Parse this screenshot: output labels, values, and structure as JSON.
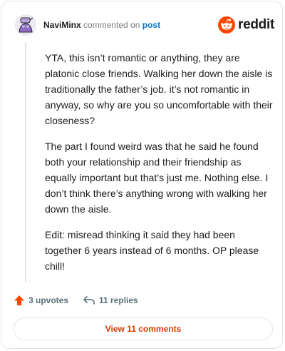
{
  "header": {
    "username": "NaviMinx",
    "action_text": "commented on",
    "post_link_label": "post",
    "brand_wordmark": "reddit"
  },
  "comment": {
    "paragraphs": [
      "YTA, this isn’t romantic or anything, they are platonic close friends. Walking her down the aisle is traditionally the father’s job. it’s not romantic in anyway, so why are you so uncomfortable with their closeness?",
      "The part I found weird was that he said he found both your relationship and their friendship as equally important but that’s just me. Nothing else. I don’t think there’s anything wrong with walking her down the aisle.",
      "Edit: misread thinking it said they had been together 6 years instead of 6 months. OP please chill!"
    ]
  },
  "actions": {
    "upvotes_label": "3 upvotes",
    "replies_label": "11 replies"
  },
  "footer": {
    "view_button_label": "View 11 comments"
  },
  "icons": {
    "upvote": "upvote-arrow-icon",
    "reply": "reply-arrow-icon",
    "brand": "reddit-snoo-icon",
    "avatar": "user-avatar"
  },
  "colors": {
    "upvote_accent": "#ff4500",
    "link_blue": "#0079d3",
    "button_text": "#d93a00",
    "brand_orange": "#ff4500",
    "muted_text": "#576f76"
  }
}
